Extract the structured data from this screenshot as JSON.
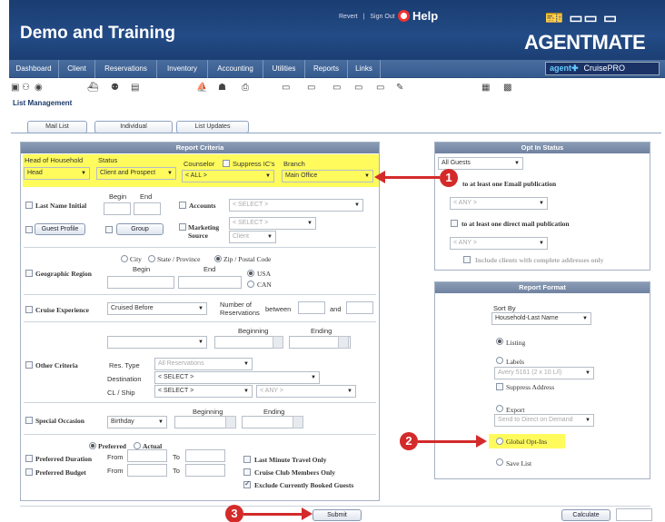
{
  "header": {
    "title": "Demo and Training",
    "links": [
      "Revert",
      "|",
      "Sign Out"
    ],
    "help": "Help",
    "logo_top": "🎫 ▭▭ ▭",
    "logo": "AGENTMATE"
  },
  "nav": {
    "items": [
      "Dashboard",
      "Client",
      "Reservations",
      "Inventory",
      "Accounting",
      "Utilities",
      "Reports",
      "Links"
    ],
    "brand_a": "agent✚",
    "brand_b": "CruisePRO"
  },
  "page": {
    "section_title": "List Management",
    "tabs": [
      "Mail List",
      "Individual",
      "List Updates"
    ]
  },
  "report_criteria": {
    "title": "Report Criteria",
    "head_of_household": {
      "label": "Head of Household",
      "value": "Head"
    },
    "status": {
      "label": "Status",
      "value": "Client and Prospect"
    },
    "counselor": {
      "label": "Counselor",
      "value": "< ALL >"
    },
    "suppress_ics": "Suppress IC's",
    "branch": {
      "label": "Branch",
      "value": "Main Office"
    },
    "last_name": {
      "label": "Last Name Initial",
      "begin": "Begin",
      "end": "End"
    },
    "accounts": {
      "label": "Accounts",
      "value": "< SELECT >"
    },
    "guest_profile": "Guest Profile",
    "group": "Group",
    "marketing_source": {
      "label1": "Marketing",
      "label2": "Source",
      "value": "< SELECT >",
      "client": "Client"
    },
    "geo": {
      "label": "Geographic Region",
      "city": "City",
      "state": "State / Province",
      "zip": "Zip / Postal Code",
      "begin": "Begin",
      "end": "End",
      "usa": "USA",
      "can": "CAN"
    },
    "cruise": {
      "label": "Cruise Experience",
      "value": "Cruised Before",
      "num_res1": "Number of",
      "num_res2": "Reservations",
      "between": "between",
      "and": "and"
    },
    "other": {
      "label": "Other Criteria",
      "beginning": "Beginning",
      "ending": "Ending",
      "res_type": "Res. Type",
      "res_type_value": "All Reservations",
      "destination": "Destination",
      "destination_value": "< SELECT >",
      "clship": "CL / Ship",
      "clship_value": "< SELECT >",
      "any": "< ANY >"
    },
    "special": {
      "label": "Special Occasion",
      "value": "Birthday",
      "beginning": "Beginning",
      "ending": "Ending"
    },
    "preferred": {
      "preferred": "Preferred",
      "actual": "Actual",
      "duration": "Preferred Duration",
      "budget": "Preferred Budget",
      "from": "From",
      "to": "To"
    },
    "options": [
      "Last Minute Travel Only",
      "Cruise Club Members Only",
      "Exclude Currently Booked Guests"
    ]
  },
  "opt_in": {
    "title": "Opt In Status",
    "all_guests": "All Guests",
    "email": "to at least one Email publication",
    "email_any": "< ANY >",
    "mail": "to at least one direct mail publication",
    "mail_any": "< ANY >",
    "complete": "Include clients with complete addresses only"
  },
  "report_format": {
    "title": "Report Format",
    "sort_by": "Sort By",
    "sort_value": "Household-Last Name",
    "listing": "Listing",
    "labels": "Labels",
    "labels_value": "Avery 5161 (2 x 10 L/l)",
    "suppress": "Suppress Address",
    "export": "Export",
    "export_value": "Send to Direct on Demand",
    "global": "Global Opt-Ins",
    "save": "Save List"
  },
  "buttons": {
    "submit": "Submit",
    "calculate": "Calculate"
  },
  "callouts": [
    "1",
    "2",
    "3"
  ],
  "colors": {
    "header_bg": "#1f4680",
    "highlight": "#fffb5c",
    "callout": "#d42a2a"
  }
}
